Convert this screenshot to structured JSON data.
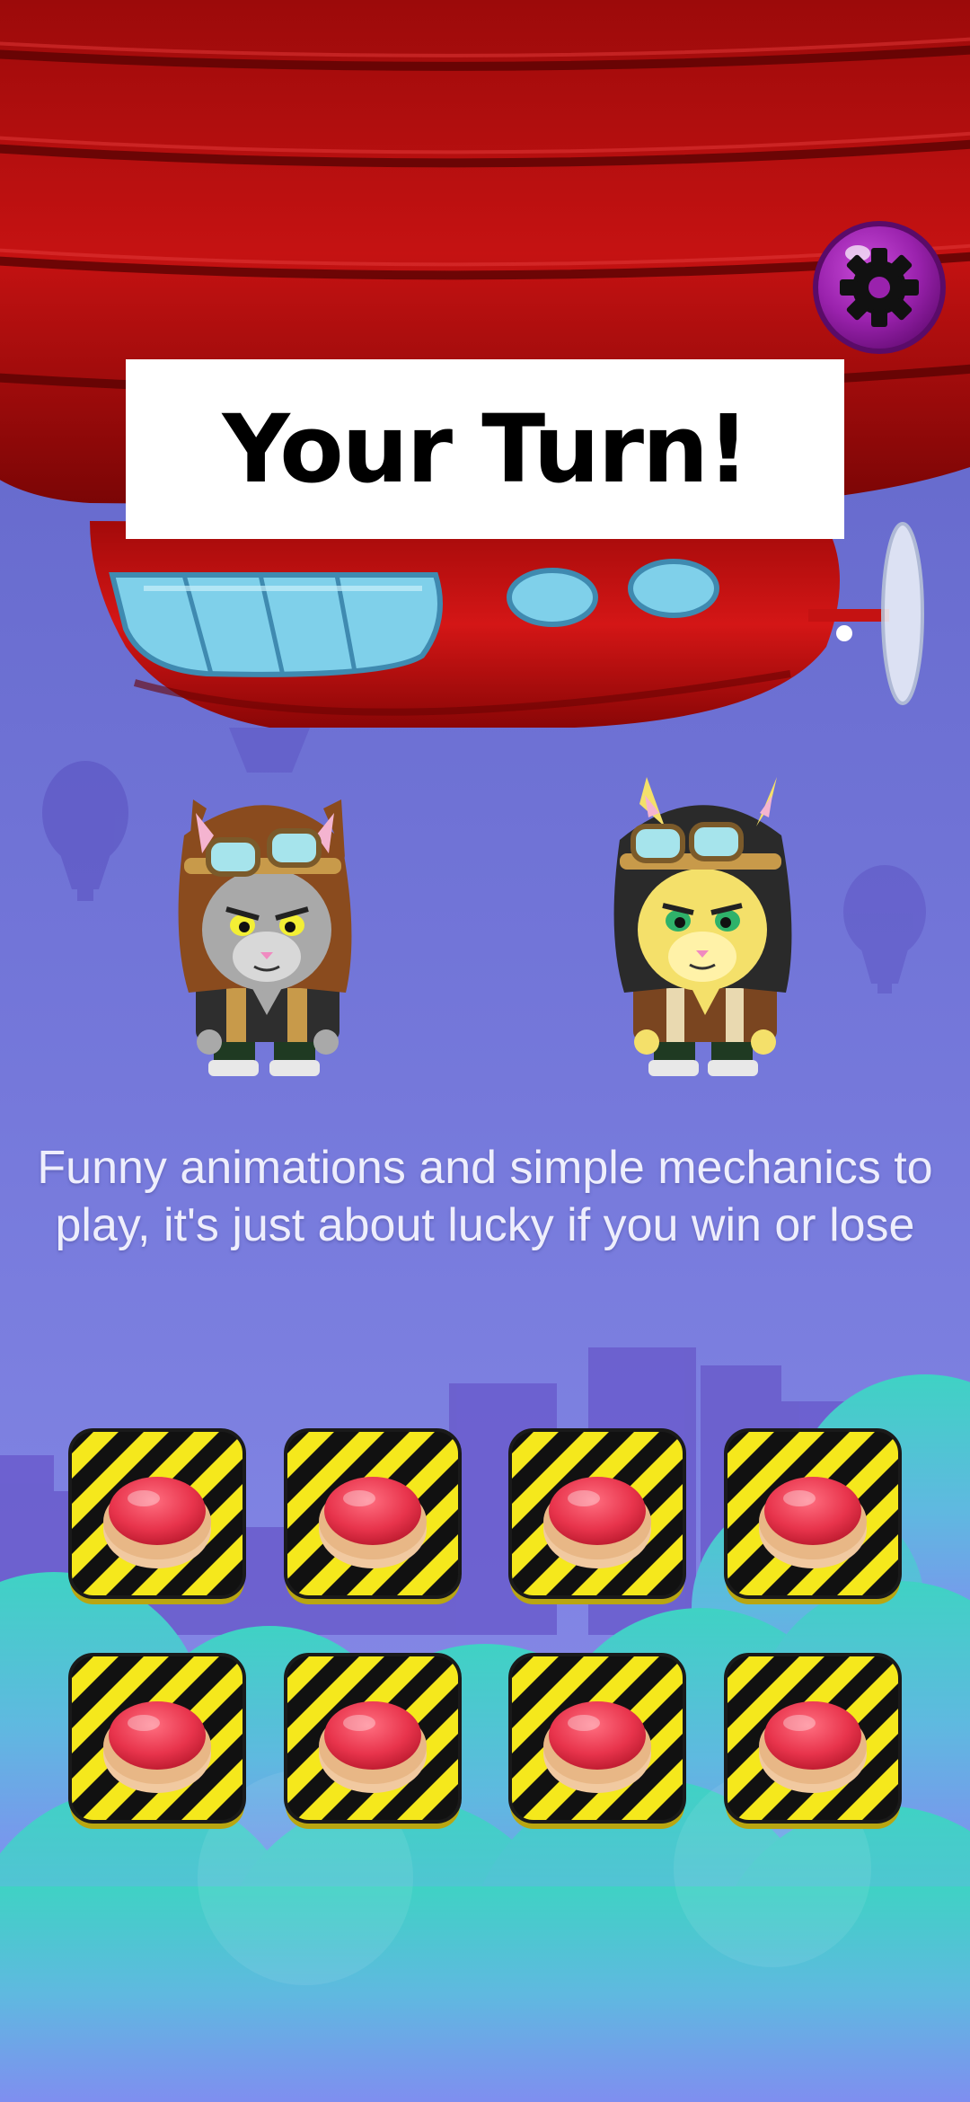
{
  "turn_banner": {
    "text": "Your Turn!"
  },
  "settings": {
    "icon": "gear-icon",
    "color": "#8e1f9c"
  },
  "tagline": {
    "line1": "Funny animations and simple mechanics to",
    "line2": "play, it's just about lucky if you win or lose"
  },
  "players": [
    {
      "name": "gray-cat",
      "fur_color": "#a9a9a9",
      "helmet_color": "#8a4b1e"
    },
    {
      "name": "yellow-cat",
      "fur_color": "#f4e06a",
      "helmet_color": "#2a2a2a"
    }
  ],
  "buttons": {
    "count": 8,
    "rows": 2,
    "columns": 4,
    "button_color": "#e8344c",
    "stripe_colors": [
      "#f5e81c",
      "#111111"
    ]
  },
  "colors": {
    "airship_red": "#b30d0d",
    "sky": "#7274d8",
    "cloud": "#4fd6c6"
  }
}
